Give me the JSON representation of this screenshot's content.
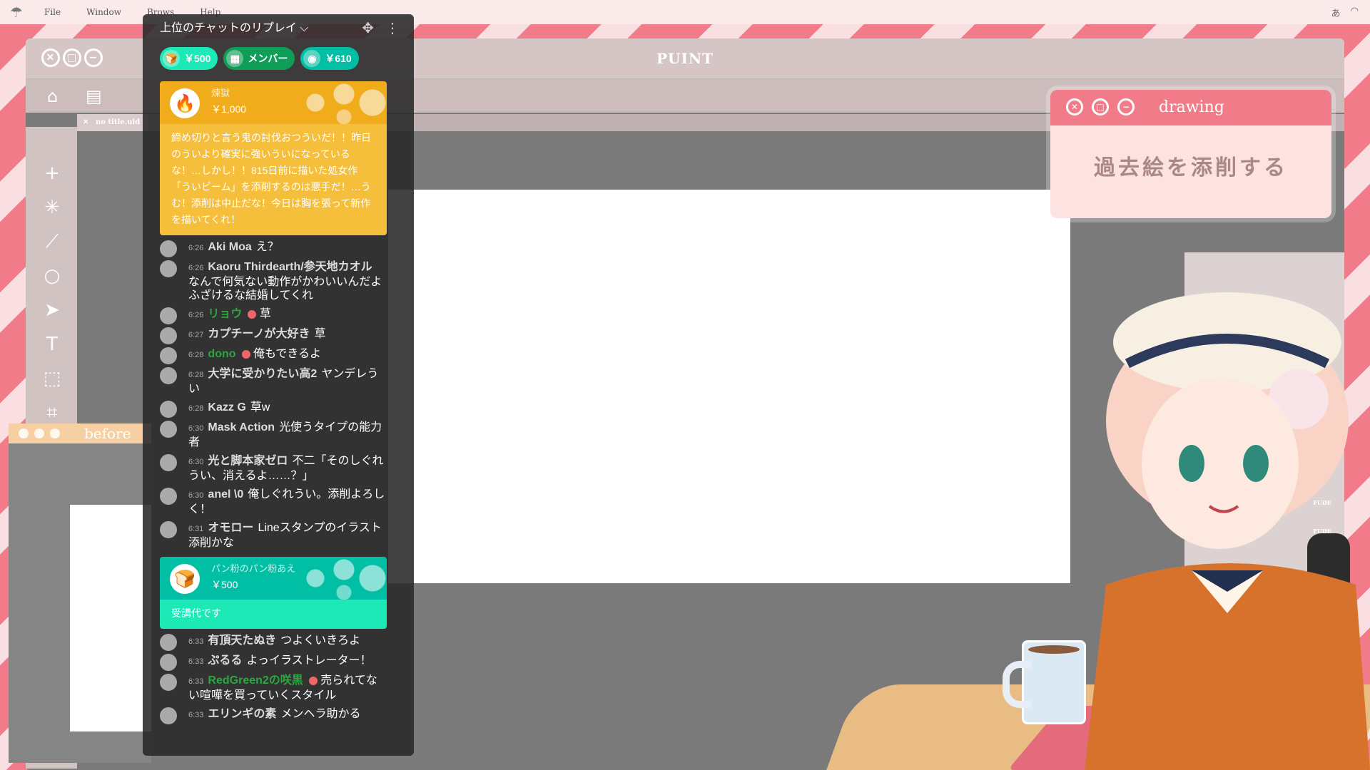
{
  "menubar": {
    "items": [
      "File",
      "Window",
      "Brows",
      "Help"
    ]
  },
  "app": {
    "title": "PUINT",
    "tab_label": "no title.uid"
  },
  "drawing_window": {
    "title": "drawing",
    "body": "過去絵を添削する"
  },
  "before_window": {
    "title": "before"
  },
  "chat": {
    "header": "上位のチャットのリプレイ ⌵",
    "tickers": [
      {
        "label": "￥500",
        "color": "#1de9b6",
        "icon": "bread-icon"
      },
      {
        "label": "メンバー",
        "color": "#0f9d58",
        "icon": "member-icon"
      },
      {
        "label": "￥610",
        "color": "#00bfa5",
        "icon": "avatar-icon"
      }
    ],
    "superchats": [
      {
        "name": "煉獄",
        "amount": "￥1,000",
        "message": "締め切りと言う鬼の討伐おつういだ！！昨日のういより確実に強いういになっているな！…しかし！！815日前に描いた処女作「ういビーム」を添削するのは悪手だ！…うむ！添削は中止だな！今日は胸を張って新作を描いてくれ！",
        "top_color": "#f0ac1a",
        "body_color": "#f5bf3c"
      }
    ],
    "messages": [
      {
        "time": "6:26",
        "author": "Aki Moa",
        "text": "え？",
        "member": false
      },
      {
        "time": "6:26",
        "author": "Kaoru Thirdearth/参天地カオル",
        "text": "なんで何気ない動作がかわいいんだよふざけるな結婚してくれ",
        "member": false
      },
      {
        "time": "6:26",
        "author": "リョウ",
        "text": "草",
        "member": true
      },
      {
        "time": "6:27",
        "author": "カプチーノが大好き",
        "text": "草",
        "member": false
      },
      {
        "time": "6:28",
        "author": "dono",
        "text": "俺もできるよ",
        "member": true
      },
      {
        "time": "6:28",
        "author": "大学に受かりたい高2",
        "text": "ヤンデレうい",
        "member": false
      },
      {
        "time": "6:28",
        "author": "Kazz G",
        "text": "草w",
        "member": false
      },
      {
        "time": "6:30",
        "author": "Mask Action",
        "text": "光使うタイプの能力者",
        "member": false
      },
      {
        "time": "6:30",
        "author": "光と脚本家ゼロ",
        "text": "不二「そのしぐれうい、消えるよ……？」",
        "member": false
      },
      {
        "time": "6:30",
        "author": "anel \\0",
        "text": "俺しぐれうい。添削よろしく！",
        "member": false
      },
      {
        "time": "6:31",
        "author": "オモロー",
        "text": "Lineスタンプのイラスト添削かな",
        "member": false
      }
    ],
    "superchat2": {
      "name": "パン粉のパン粉あえ",
      "amount": "￥500",
      "message": "受講代です",
      "top_color": "#00bfa5",
      "body_color": "#1de9b6"
    },
    "messages2": [
      {
        "time": "6:33",
        "author": "有頂天たぬき",
        "text": "つよくいきろよ",
        "member": false
      },
      {
        "time": "6:33",
        "author": "ぷるる",
        "text": "よっイラストレーター！",
        "member": false
      },
      {
        "time": "6:33",
        "author": "RedGreen2の咲黒",
        "text": "売られてない喧嘩を買っていくスタイル",
        "member": true
      },
      {
        "time": "6:33",
        "author": "エリンギの素",
        "text": "メンヘラ助かる",
        "member": false
      }
    ]
  }
}
